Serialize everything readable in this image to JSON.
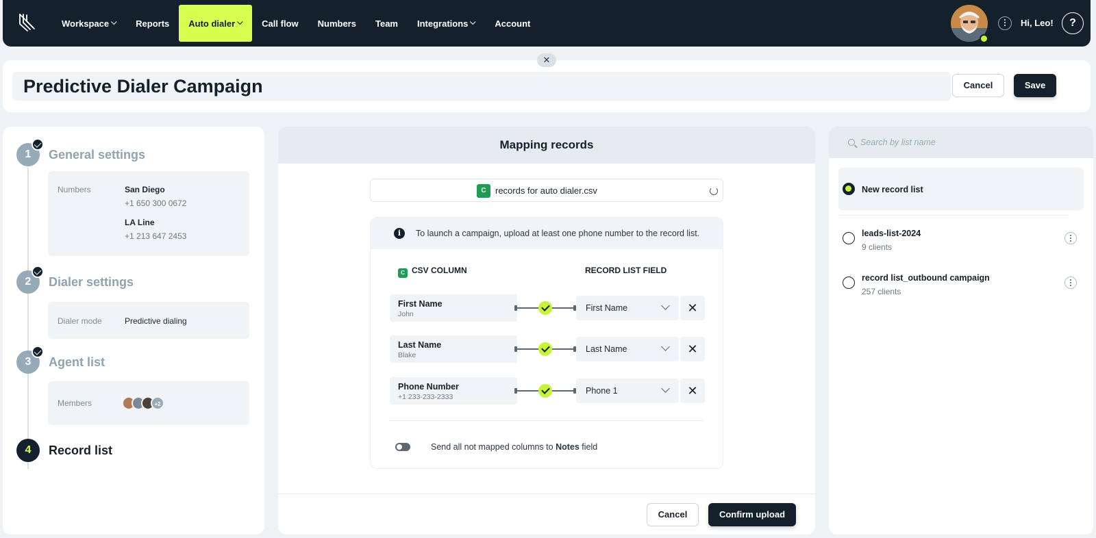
{
  "nav": {
    "items": [
      {
        "label": "Workspace",
        "dropdown": true,
        "active": false
      },
      {
        "label": "Reports",
        "dropdown": false,
        "active": false
      },
      {
        "label": "Auto dialer",
        "dropdown": true,
        "active": true
      },
      {
        "label": "Call flow",
        "dropdown": false,
        "active": false
      },
      {
        "label": "Numbers",
        "dropdown": false,
        "active": false
      },
      {
        "label": "Team",
        "dropdown": false,
        "active": false
      },
      {
        "label": "Integrations",
        "dropdown": true,
        "active": false
      },
      {
        "label": "Account",
        "dropdown": false,
        "active": false
      }
    ],
    "greeting": "Hi, Leo!",
    "help_glyph": "?"
  },
  "page": {
    "close_glyph": "✕",
    "title": "Predictive Dialer Campaign",
    "cancel_label": "Cancel",
    "save_label": "Save"
  },
  "steps": [
    {
      "num": "1",
      "title": "General settings",
      "done": true
    },
    {
      "num": "2",
      "title": "Dialer settings",
      "done": true
    },
    {
      "num": "3",
      "title": "Agent list",
      "done": true
    },
    {
      "num": "4",
      "title": "Record list",
      "done": false
    }
  ],
  "general": {
    "numbers_label": "Numbers",
    "lines": [
      {
        "name": "San Diego",
        "phone": "+1 650 300 0672"
      },
      {
        "name": "LA Line",
        "phone": "+1 213 647 2453"
      }
    ]
  },
  "dialer": {
    "mode_label": "Dialer mode",
    "mode_value": "Predictive dialing"
  },
  "agents": {
    "members_label": "Members",
    "more_count": "+2"
  },
  "mapping": {
    "title": "Mapping records",
    "file_icon": "C",
    "file_name": "records for auto dialer.csv",
    "notice_icon": "i",
    "notice": "To launch a campaign, upload at least one phone number to the record list.",
    "csv_col_header": "CSV COLUMN",
    "record_field_header": "RECORD LIST FIELD",
    "rows": [
      {
        "source": "First Name",
        "sample": "John",
        "target": "First Name"
      },
      {
        "source": "Last Name",
        "sample": "Blake",
        "target": "Last Name"
      },
      {
        "source": "Phone Number",
        "sample": "+1 233-233-2333",
        "target": "Phone 1"
      }
    ],
    "remove_glyph": "✕",
    "toggle_text_before": "Send all not mapped columns to ",
    "toggle_text_bold": "Notes",
    "toggle_text_after": " field",
    "toggle_on": false,
    "cancel_label": "Cancel",
    "confirm_label": "Confirm upload"
  },
  "lists": {
    "search_placeholder": "Search by list name",
    "items": [
      {
        "title": "New record list",
        "sub": "",
        "selected": true
      },
      {
        "title": "leads-list-2024",
        "sub": "9 clients",
        "selected": false
      },
      {
        "title": "record list_outbound campaign",
        "sub": "257 clients",
        "selected": false
      }
    ]
  },
  "colors": {
    "accent": "#d7ff4f",
    "dark": "#15202d",
    "success": "#1f9d55"
  }
}
